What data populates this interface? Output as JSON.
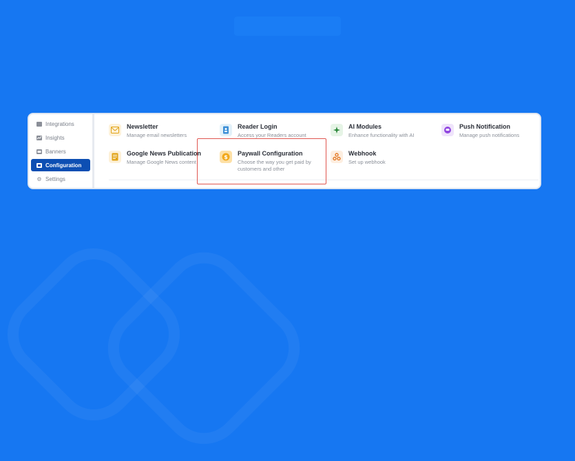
{
  "sidebar": {
    "items": [
      {
        "label": "Integrations",
        "icon": "integrations-icon",
        "active": false
      },
      {
        "label": "Insights",
        "icon": "insights-icon",
        "active": false
      },
      {
        "label": "Banners",
        "icon": "banners-icon",
        "active": false
      },
      {
        "label": "Configuration",
        "icon": "configuration-icon",
        "active": true
      },
      {
        "label": "Settings",
        "icon": "settings-icon",
        "active": false
      }
    ]
  },
  "cards": [
    {
      "title": "Newsletter",
      "desc": "Manage email newsletters",
      "icon": "newsletter-icon",
      "tile_color": "#fdf1d8"
    },
    {
      "title": "Reader Login",
      "desc": "Access your Readers account",
      "icon": "reader-login-icon",
      "tile_color": "#e3f1f9"
    },
    {
      "title": "AI Modules",
      "desc": "Enhance functionality with AI",
      "icon": "ai-sparkle-icon",
      "tile_color": "#e6f4e6"
    },
    {
      "title": "Push Notification",
      "desc": "Manage push notifications",
      "icon": "push-notification-icon",
      "tile_color": "#efe4fb"
    },
    {
      "title": "Google News Publication",
      "desc": "Manage Google News content",
      "icon": "google-news-icon",
      "tile_color": "#fdf1d8"
    },
    {
      "title": "Paywall Configuration",
      "desc_line1": "Choose the way you get paid by",
      "desc_line2": "customers and other",
      "icon": "paywall-dollar-icon",
      "tile_color": "#fde0a6"
    },
    {
      "title": "Webhook",
      "desc": "Set up webhook",
      "icon": "webhook-icon",
      "tile_color": "#fdeee0"
    }
  ],
  "colors": {
    "background": "#1677f2",
    "active_nav": "#0d4fb3",
    "highlight_border": "#e0554f"
  }
}
